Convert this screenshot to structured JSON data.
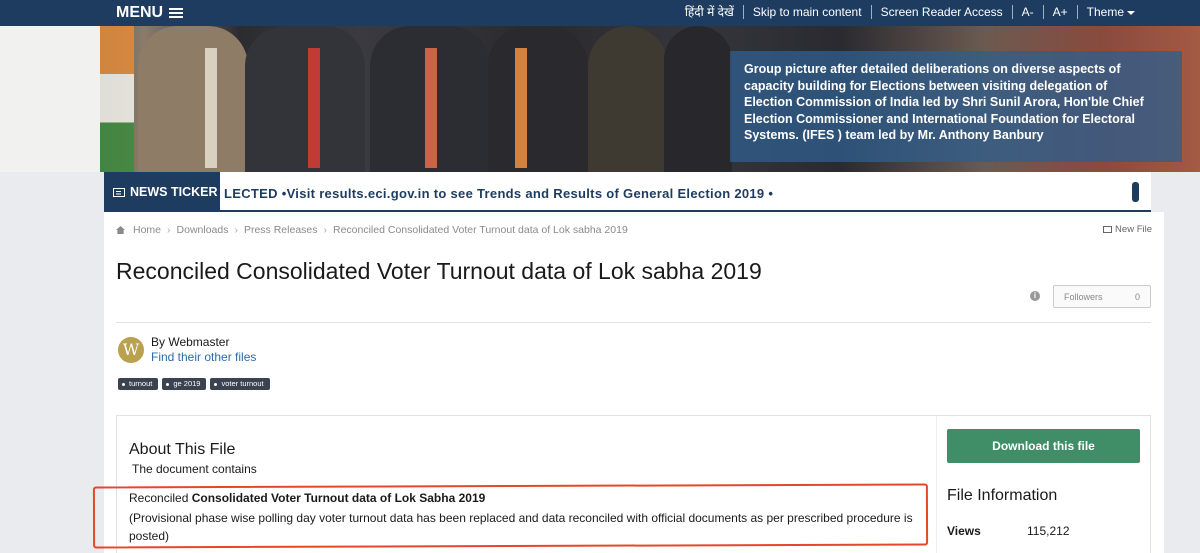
{
  "topbar": {
    "menu_label": "MENU",
    "links": [
      "हिंदी में देखें",
      "Skip to main content",
      "Screen Reader Access",
      "A-",
      "A+",
      "Theme"
    ]
  },
  "hero": {
    "caption_lines": [
      "Group picture after detailed deliberations on diverse aspects of",
      "capacity building for Elections between visiting delegation of",
      "Election Commission of India led by Shri Sunil Arora, Hon'ble Chief",
      "Election Commissioner and International Foundation for Electoral",
      "Systems. (IFES ) team led by Mr. Anthony Banbury"
    ]
  },
  "ticker": {
    "label": "NEWS TICKER",
    "text": "LECTED   •Visit results.eci.gov.in to see Trends and Results of General Election 2019   •"
  },
  "breadcrumb": [
    "Home",
    "Downloads",
    "Press Releases",
    "Reconciled Consolidated Voter Turnout data of Lok sabha 2019"
  ],
  "new_file_label": "New File",
  "page_title": "Reconciled Consolidated Voter Turnout data of Lok sabha 2019",
  "followers": {
    "label": "Followers",
    "count": "0"
  },
  "author": {
    "initial": "W",
    "byline": "By Webmaster",
    "find_link": "Find their other files"
  },
  "tags": [
    "turnout",
    "ge 2019",
    "voter turnout"
  ],
  "about": {
    "title": "About This File",
    "subtitle": "The document contains",
    "line1_prefix": "Reconciled ",
    "line1_bold": "Consolidated Voter Turnout data of Lok Sabha 2019",
    "line2": "(Provisional phase wise polling day voter turnout data has been replaced and data reconciled with official documents as per prescribed procedure is posted)"
  },
  "sidebar": {
    "download_label": "Download this file",
    "file_info_title": "File Information",
    "views_label": "Views",
    "views_value": "115,212"
  },
  "colors": {
    "navy": "#1d3c5f",
    "download_green": "#3f8e68",
    "highlight_red": "#e5472a",
    "link_blue": "#2d6aa8"
  }
}
